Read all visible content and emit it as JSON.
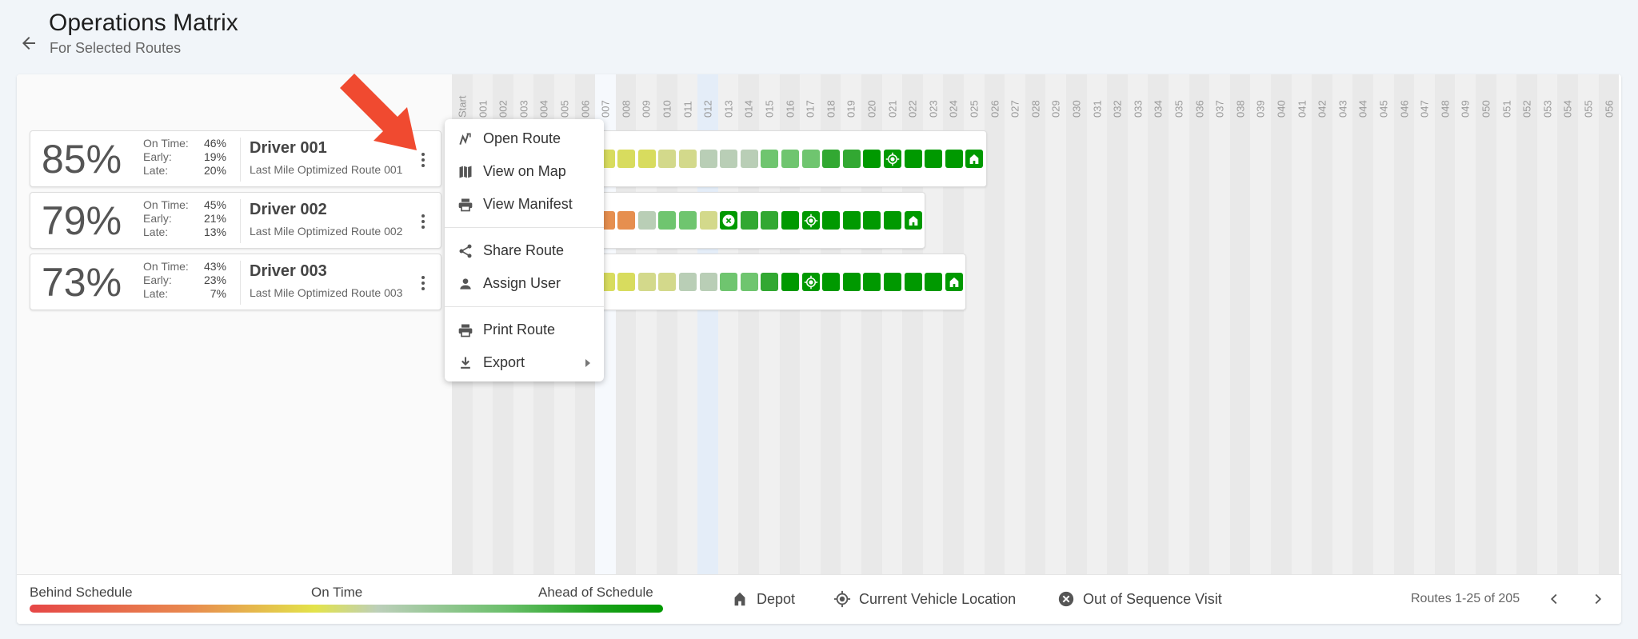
{
  "header": {
    "title": "Operations Matrix",
    "subtitle": "For Selected Routes",
    "back_icon": "arrow-left-icon"
  },
  "columns": [
    "Start",
    "001",
    "002",
    "003",
    "004",
    "005",
    "006",
    "007",
    "008",
    "009",
    "010",
    "011",
    "012",
    "013",
    "014",
    "015",
    "016",
    "017",
    "018",
    "019",
    "020",
    "021",
    "022",
    "023",
    "024",
    "025",
    "026",
    "027",
    "028",
    "029",
    "030",
    "031",
    "032",
    "033",
    "034",
    "035",
    "036",
    "037",
    "038",
    "039",
    "040",
    "041",
    "042",
    "043",
    "044",
    "045",
    "046",
    "047",
    "048",
    "049",
    "050",
    "051",
    "052",
    "053",
    "054",
    "055",
    "056"
  ],
  "highlighted_columns": [
    "007",
    "012"
  ],
  "status_colors": {
    "behind": "#e68f4f",
    "yellow": "#d8dc5e",
    "olive": "#d3d98b",
    "neutral": "#b9ceb6",
    "light": "#6fc56f",
    "medium": "#32a832",
    "ahead": "#009900"
  },
  "routes": [
    {
      "score": "85%",
      "on_time_label": "On Time:",
      "on_time": "46%",
      "early_label": "Early:",
      "early": "19%",
      "late_label": "Late:",
      "late": "20%",
      "driver": "Driver 001",
      "route": "Last Mile Optimized Route 001",
      "stops": [
        [
          "007",
          "yellow"
        ],
        [
          "008",
          "yellow"
        ],
        [
          "009",
          "yellow"
        ],
        [
          "010",
          "olive"
        ],
        [
          "011",
          "olive"
        ],
        [
          "012",
          "neutral"
        ],
        [
          "013",
          "neutral"
        ],
        [
          "014",
          "neutral"
        ],
        [
          "015",
          "light"
        ],
        [
          "016",
          "light"
        ],
        [
          "017",
          "light"
        ],
        [
          "018",
          "medium"
        ],
        [
          "019",
          "medium"
        ],
        [
          "020",
          "ahead"
        ],
        [
          "021",
          "ahead",
          "location"
        ],
        [
          "022",
          "ahead"
        ],
        [
          "023",
          "ahead"
        ],
        [
          "024",
          "ahead"
        ],
        [
          "025",
          "ahead",
          "depot"
        ]
      ]
    },
    {
      "score": "79%",
      "on_time_label": "On Time:",
      "on_time": "45%",
      "early_label": "Early:",
      "early": "21%",
      "late_label": "Late:",
      "late": "13%",
      "driver": "Driver 002",
      "route": "Last Mile Optimized Route 002",
      "stops": [
        [
          "007",
          "behind"
        ],
        [
          "008",
          "behind"
        ],
        [
          "009",
          "neutral"
        ],
        [
          "010",
          "light"
        ],
        [
          "011",
          "light"
        ],
        [
          "012",
          "olive"
        ],
        [
          "013",
          "ahead",
          "out-of-sequence"
        ],
        [
          "014",
          "medium"
        ],
        [
          "015",
          "medium"
        ],
        [
          "016",
          "ahead"
        ],
        [
          "017",
          "ahead",
          "location"
        ],
        [
          "018",
          "ahead"
        ],
        [
          "019",
          "ahead"
        ],
        [
          "020",
          "ahead"
        ],
        [
          "021",
          "ahead"
        ],
        [
          "022",
          "ahead",
          "depot"
        ]
      ]
    },
    {
      "score": "73%",
      "on_time_label": "On Time:",
      "on_time": "43%",
      "early_label": "Early:",
      "early": "23%",
      "late_label": "Late:",
      "late": "7%",
      "driver": "Driver 003",
      "route": "Last Mile Optimized Route 003",
      "stops": [
        [
          "007",
          "yellow"
        ],
        [
          "008",
          "yellow"
        ],
        [
          "009",
          "olive"
        ],
        [
          "010",
          "olive"
        ],
        [
          "011",
          "neutral"
        ],
        [
          "012",
          "neutral"
        ],
        [
          "013",
          "light"
        ],
        [
          "014",
          "light"
        ],
        [
          "015",
          "medium"
        ],
        [
          "016",
          "ahead"
        ],
        [
          "017",
          "ahead",
          "location"
        ],
        [
          "018",
          "ahead"
        ],
        [
          "019",
          "ahead"
        ],
        [
          "020",
          "ahead"
        ],
        [
          "021",
          "ahead"
        ],
        [
          "022",
          "ahead"
        ],
        [
          "023",
          "ahead"
        ],
        [
          "024",
          "ahead",
          "depot"
        ]
      ]
    }
  ],
  "menu": {
    "items": [
      {
        "label": "Open Route",
        "icon": "route-icon"
      },
      {
        "label": "View on Map",
        "icon": "map-icon"
      },
      {
        "label": "View Manifest",
        "icon": "printer-icon"
      },
      {
        "label": "Share Route",
        "icon": "share-icon"
      },
      {
        "label": "Assign User",
        "icon": "user-icon"
      },
      {
        "label": "Print Route",
        "icon": "printer-icon"
      },
      {
        "label": "Export",
        "icon": "download-icon"
      }
    ]
  },
  "footer": {
    "behind": "Behind Schedule",
    "on_time": "On Time",
    "ahead": "Ahead of Schedule",
    "depot": "Depot",
    "location": "Current Vehicle Location",
    "out_of_sequence": "Out of Sequence Visit",
    "pager": "Routes 1-25 of 205"
  },
  "annotation_color": "#f04a30"
}
